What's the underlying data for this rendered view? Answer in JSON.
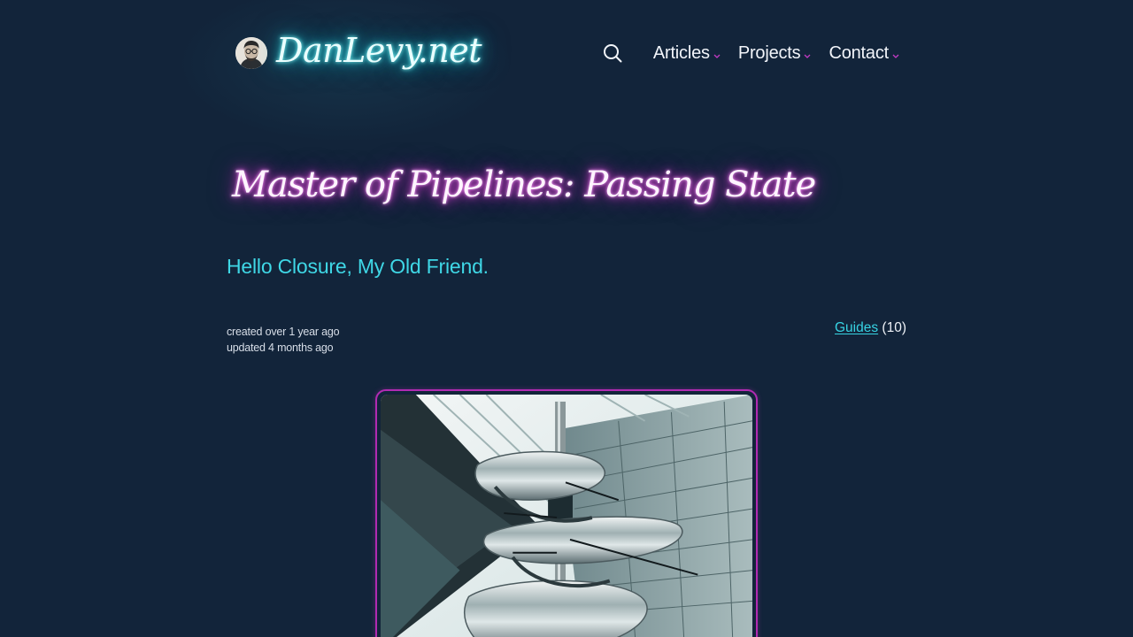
{
  "header": {
    "site_title": "DanLevy.net",
    "nav": [
      {
        "label": "Articles"
      },
      {
        "label": "Projects"
      },
      {
        "label": "Contact"
      }
    ]
  },
  "post": {
    "title": "Master of Pipelines: Passing State",
    "subtitle": "Hello Closure, My Old Friend.",
    "created": "created over 1 year ago",
    "updated": "updated 4 months ago",
    "category": {
      "name": "Guides",
      "count": "(10)"
    }
  },
  "icons": {
    "search": "search-icon",
    "chevron": "chevron-down-icon"
  },
  "colors": {
    "background": "#12243a",
    "accent_cyan": "#3fd7e6",
    "accent_magenta": "#b12bb2",
    "nav_chevron": "#c43ac4"
  }
}
